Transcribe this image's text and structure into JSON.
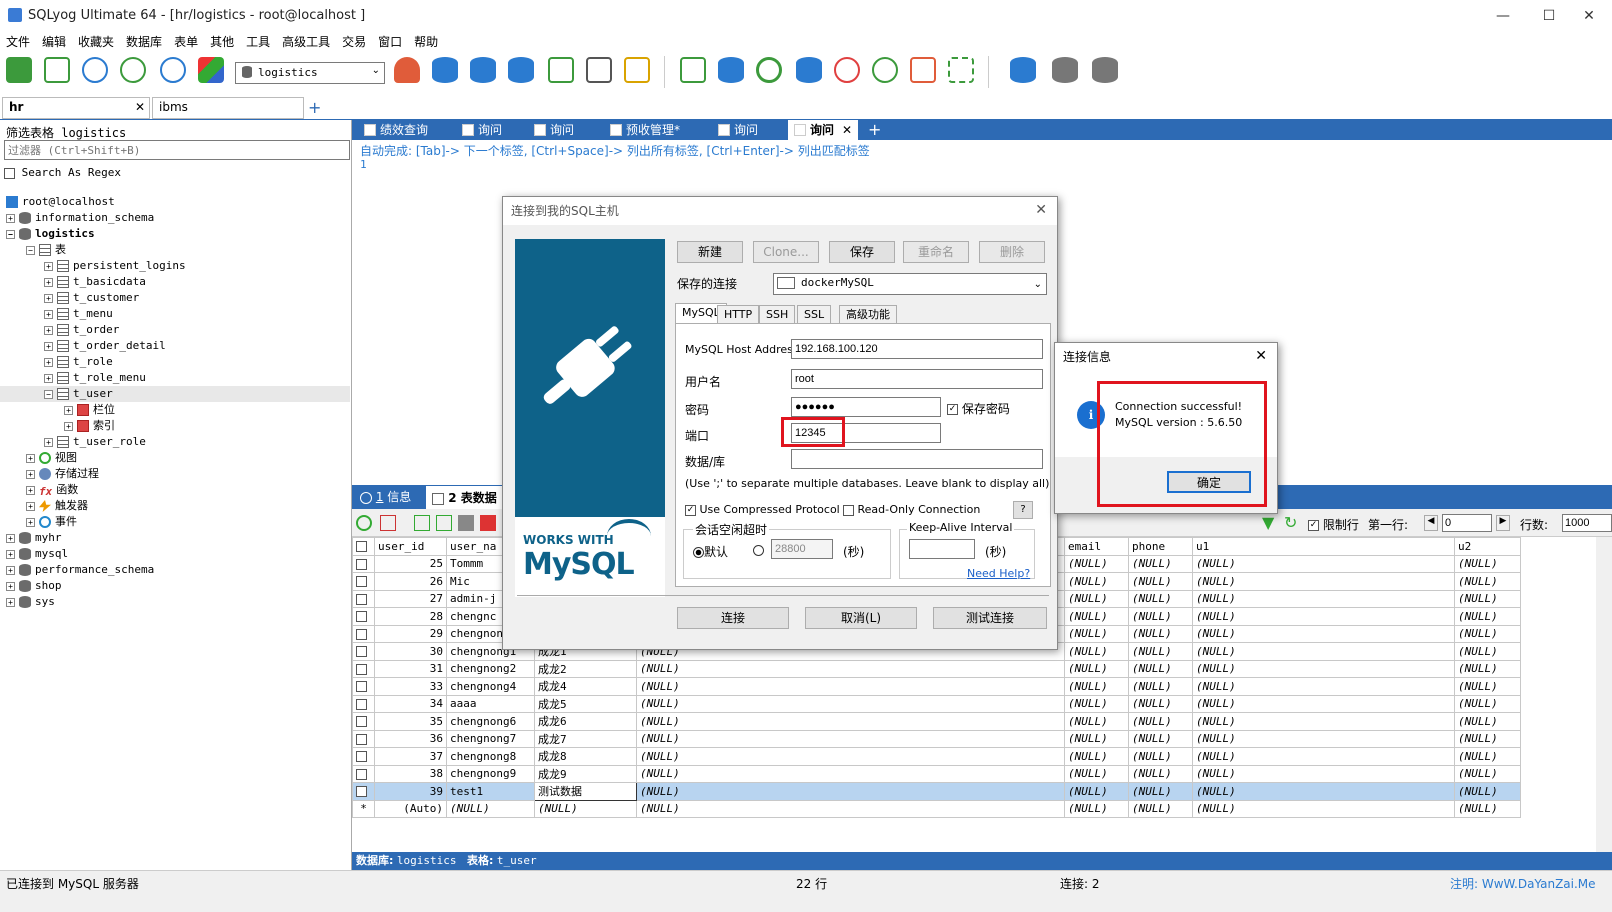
{
  "window": {
    "title": "SQLyog Ultimate 64 - [hr/logistics - root@localhost ]"
  },
  "menu": [
    "文件",
    "编辑",
    "收藏夹",
    "数据库",
    "表单",
    "其他",
    "工具",
    "高级工具",
    "交易",
    "窗口",
    "帮助"
  ],
  "toolbar": {
    "database": "logistics"
  },
  "connection_tabs": [
    {
      "label": "hr"
    },
    {
      "label": "ibms"
    }
  ],
  "left": {
    "filter_title": "筛选表格 logistics",
    "filter_placeholder": "过滤器 (Ctrl+Shift+B)",
    "regex_label": "Search As Regex",
    "tree": {
      "root": "root@localhost",
      "information_schema": "information_schema",
      "logistics": "logistics",
      "tables_label": "表",
      "tables": [
        "persistent_logins",
        "t_basicdata",
        "t_customer",
        "t_menu",
        "t_order",
        "t_order_detail",
        "t_role",
        "t_role_menu",
        "t_user"
      ],
      "columns_label": "栏位",
      "index_label": "索引",
      "last_table": "t_user_role",
      "views": "视图",
      "procs": "存储过程",
      "funcs": "函数",
      "triggers": "触发器",
      "events": "事件",
      "other_dbs": [
        "myhr",
        "mysql",
        "performance_schema",
        "shop",
        "sys"
      ]
    }
  },
  "editor_tabs": [
    "绩效查询",
    "询问",
    "询问",
    "预收管理*",
    "询问",
    "询问"
  ],
  "editor": {
    "hint": "自动完成: [Tab]-> 下一个标签, [Ctrl+Space]-> 列出所有标签, [Ctrl+Enter]-> 列出匹配标签",
    "line1": "1"
  },
  "result_tabs": {
    "info_num": "1",
    "info": "信息",
    "table_num": "2",
    "table": "表数据"
  },
  "result_toolbar": {
    "limit_label": "限制行",
    "first_row_label": "第一行:",
    "first_row": "0",
    "rows_label": "行数:",
    "rows": "1000"
  },
  "grid": {
    "headers": [
      "user_id",
      "user_na",
      "",
      "",
      "email",
      "phone",
      "u1",
      "u2"
    ],
    "rows": [
      [
        "25",
        "Tommm",
        "",
        "",
        "(NULL)",
        "(NULL)",
        "(NULL)",
        "(NULL)"
      ],
      [
        "26",
        "Mic",
        "",
        "",
        "(NULL)",
        "(NULL)",
        "(NULL)",
        "(NULL)"
      ],
      [
        "27",
        "admin-j",
        "",
        "",
        "(NULL)",
        "(NULL)",
        "(NULL)",
        "(NULL)"
      ],
      [
        "28",
        "chengnc",
        "",
        "",
        "(NULL)",
        "(NULL)",
        "(NULL)",
        "(NULL)"
      ],
      [
        "29",
        "chengnong0",
        "成龙0",
        "(NULL)",
        "(NULL)",
        "(NULL)",
        "(NULL)",
        "(NULL)"
      ],
      [
        "30",
        "chengnong1",
        "成龙1",
        "(NULL)",
        "(NULL)",
        "(NULL)",
        "(NULL)",
        "(NULL)"
      ],
      [
        "31",
        "chengnong2",
        "成龙2",
        "(NULL)",
        "(NULL)",
        "(NULL)",
        "(NULL)",
        "(NULL)"
      ],
      [
        "33",
        "chengnong4",
        "成龙4",
        "(NULL)",
        "(NULL)",
        "(NULL)",
        "(NULL)",
        "(NULL)"
      ],
      [
        "34",
        "aaaa",
        "成龙5",
        "(NULL)",
        "(NULL)",
        "(NULL)",
        "(NULL)",
        "(NULL)"
      ],
      [
        "35",
        "chengnong6",
        "成龙6",
        "(NULL)",
        "(NULL)",
        "(NULL)",
        "(NULL)",
        "(NULL)"
      ],
      [
        "36",
        "chengnong7",
        "成龙7",
        "(NULL)",
        "(NULL)",
        "(NULL)",
        "(NULL)",
        "(NULL)"
      ],
      [
        "37",
        "chengnong8",
        "成龙8",
        "(NULL)",
        "(NULL)",
        "(NULL)",
        "(NULL)",
        "(NULL)"
      ],
      [
        "38",
        "chengnong9",
        "成龙9",
        "(NULL)",
        "(NULL)",
        "(NULL)",
        "(NULL)",
        "(NULL)"
      ],
      [
        "39",
        "test1",
        "测试数据",
        "(NULL)",
        "(NULL)",
        "(NULL)",
        "(NULL)",
        "(NULL)"
      ],
      [
        "(Auto)",
        "(NULL)",
        "(NULL)",
        "(NULL)",
        "(NULL)",
        "(NULL)",
        "(NULL)",
        "(NULL)"
      ]
    ],
    "auto_marker": "*"
  },
  "status": {
    "db_label": "数据库:",
    "db": "logistics",
    "table_label": "表格:",
    "table": "t_user",
    "left": "已连接到 MySQL 服务器",
    "rows": "22 行",
    "conn": "连接: 2",
    "note": "注明: WwW.DaYanZai.Me"
  },
  "dialog": {
    "title": "连接到我的SQL主机",
    "new": "新建",
    "clone": "Clone...",
    "save": "保存",
    "rename": "重命名",
    "delete": "删除",
    "saved_label": "保存的连接",
    "saved_value": "dockerMySQL",
    "tabs": [
      "MySQL",
      "HTTP",
      "SSH",
      "SSL",
      "高级功能"
    ],
    "host_label": "MySQL Host Address",
    "host": "192.168.100.120",
    "user_label": "用户名",
    "user": "root",
    "pass_label": "密码",
    "pass": "●●●●●●",
    "save_pass": "保存密码",
    "port_label": "端口",
    "port": "12345",
    "db_label": "数据/库",
    "db_hint": "(Use ';' to separate multiple databases. Leave blank to display all)",
    "compress": "Use Compressed Protocol",
    "readonly": "Read-Only Connection",
    "help_q": "?",
    "timeout_label": "会话空闲超时",
    "default": "默认",
    "timeout_val": "28800",
    "sec1": "(秒)",
    "keepalive_label": "Keep-Alive Interval",
    "sec2": "(秒)",
    "need_help": "Need Help?",
    "connect": "连接",
    "cancel": "取消(L)",
    "test": "测试连接",
    "works_with": "WORKS WITH",
    "mysql": "MySQL"
  },
  "info": {
    "title": "连接信息",
    "line1": "Connection successful!",
    "line2": "MySQL version : 5.6.50",
    "ok": "确定"
  },
  "colors": {
    "accent": "#2d6ab4",
    "highlight": "#e0141e",
    "brand": "#0e6289"
  }
}
